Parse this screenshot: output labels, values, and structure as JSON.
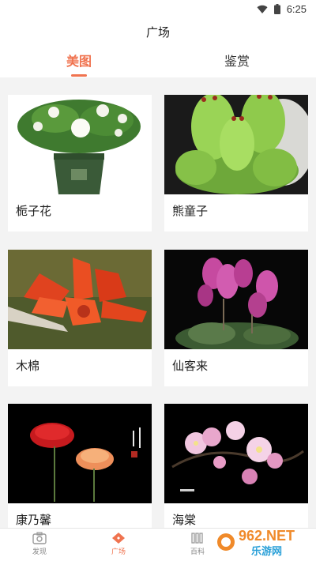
{
  "status": {
    "time": "6:25"
  },
  "header": {
    "title": "广场"
  },
  "tabs": [
    {
      "label": "美图",
      "active": true
    },
    {
      "label": "鉴赏",
      "active": false
    }
  ],
  "cards": [
    {
      "name": "栀子花"
    },
    {
      "name": "熊童子"
    },
    {
      "name": "木棉"
    },
    {
      "name": "仙客来"
    },
    {
      "name": "康乃馨"
    },
    {
      "name": "海棠"
    }
  ],
  "nav": [
    {
      "label": "发现",
      "icon": "camera-icon"
    },
    {
      "label": "广场",
      "icon": "diamond-icon"
    },
    {
      "label": "百科",
      "icon": "books-icon"
    }
  ],
  "watermark": {
    "text": "962.NET",
    "subtext": "乐游网"
  },
  "colors": {
    "accent": "#f0734f",
    "background": "#f3f3f3"
  }
}
